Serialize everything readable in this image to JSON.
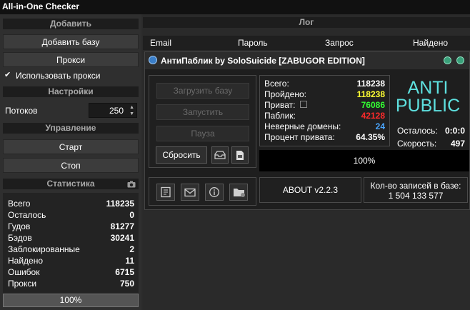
{
  "app": {
    "title": "All-in-One Checker"
  },
  "left": {
    "add_header": "Добавить",
    "add_base_button": "Добавить базу",
    "proxy_button": "Прокси",
    "use_proxy_label": "Использовать прокси",
    "use_proxy_checked": true,
    "settings_header": "Настройки",
    "threads_label": "Потоков",
    "threads_value": "250",
    "control_header": "Управление",
    "start_button": "Старт",
    "stop_button": "Стоп",
    "stats_header": "Статистика",
    "stats": [
      {
        "label": "Всего",
        "value": "118235"
      },
      {
        "label": "Осталось",
        "value": "0"
      },
      {
        "label": "Гудов",
        "value": "81277"
      },
      {
        "label": "Бэдов",
        "value": "30241"
      },
      {
        "label": "Заблокированные",
        "value": "2"
      },
      {
        "label": "Найдено",
        "value": "11"
      },
      {
        "label": "Ошибок",
        "value": "6715"
      },
      {
        "label": "Прокси",
        "value": "750"
      }
    ],
    "progress_text": "100%",
    "progress": 1.0
  },
  "log": {
    "header": "Лог",
    "columns": [
      "Email",
      "Пароль",
      "Запрос",
      "Найдено"
    ]
  },
  "popup": {
    "title": "АнтиПаблик by SoloSuicide [ZABUGOR EDITION]",
    "load_base_button": "Загрузить базу",
    "run_button": "Запустить",
    "pause_button": "Пауза",
    "reset_button": "Сбросить",
    "stats": {
      "total_label": "Всего:",
      "total_value": "118238",
      "total_color": "#ffffff",
      "passed_label": "Пройдено:",
      "passed_value": "118238",
      "passed_color": "#ffff33",
      "private_label": "Приват:",
      "private_value": "76086",
      "private_color": "#33ff33",
      "public_label": "Паблик:",
      "public_value": "42128",
      "public_color": "#ff2a2a",
      "bad_domains_label": "Неверные домены:",
      "bad_domains_value": "24",
      "bad_domains_color": "#4aa6ff",
      "private_pct_label": "Процент привата:",
      "private_pct_value": "64.35%",
      "private_pct_color": "#ffffff"
    },
    "anti_public_text_1": "ANTI",
    "anti_public_text_2": "PUBLIC",
    "remaining_label": "Осталось:",
    "remaining_value": "0:0:0",
    "speed_label": "Скорость:",
    "speed_value": "497",
    "progress_text": "100%",
    "progress": 1.0,
    "about_button": "ABOUT v2.2.3",
    "records_label": "Кол-во записей в базе:",
    "records_value": "1 504 133 577",
    "accent_color": "#5ee0df"
  }
}
